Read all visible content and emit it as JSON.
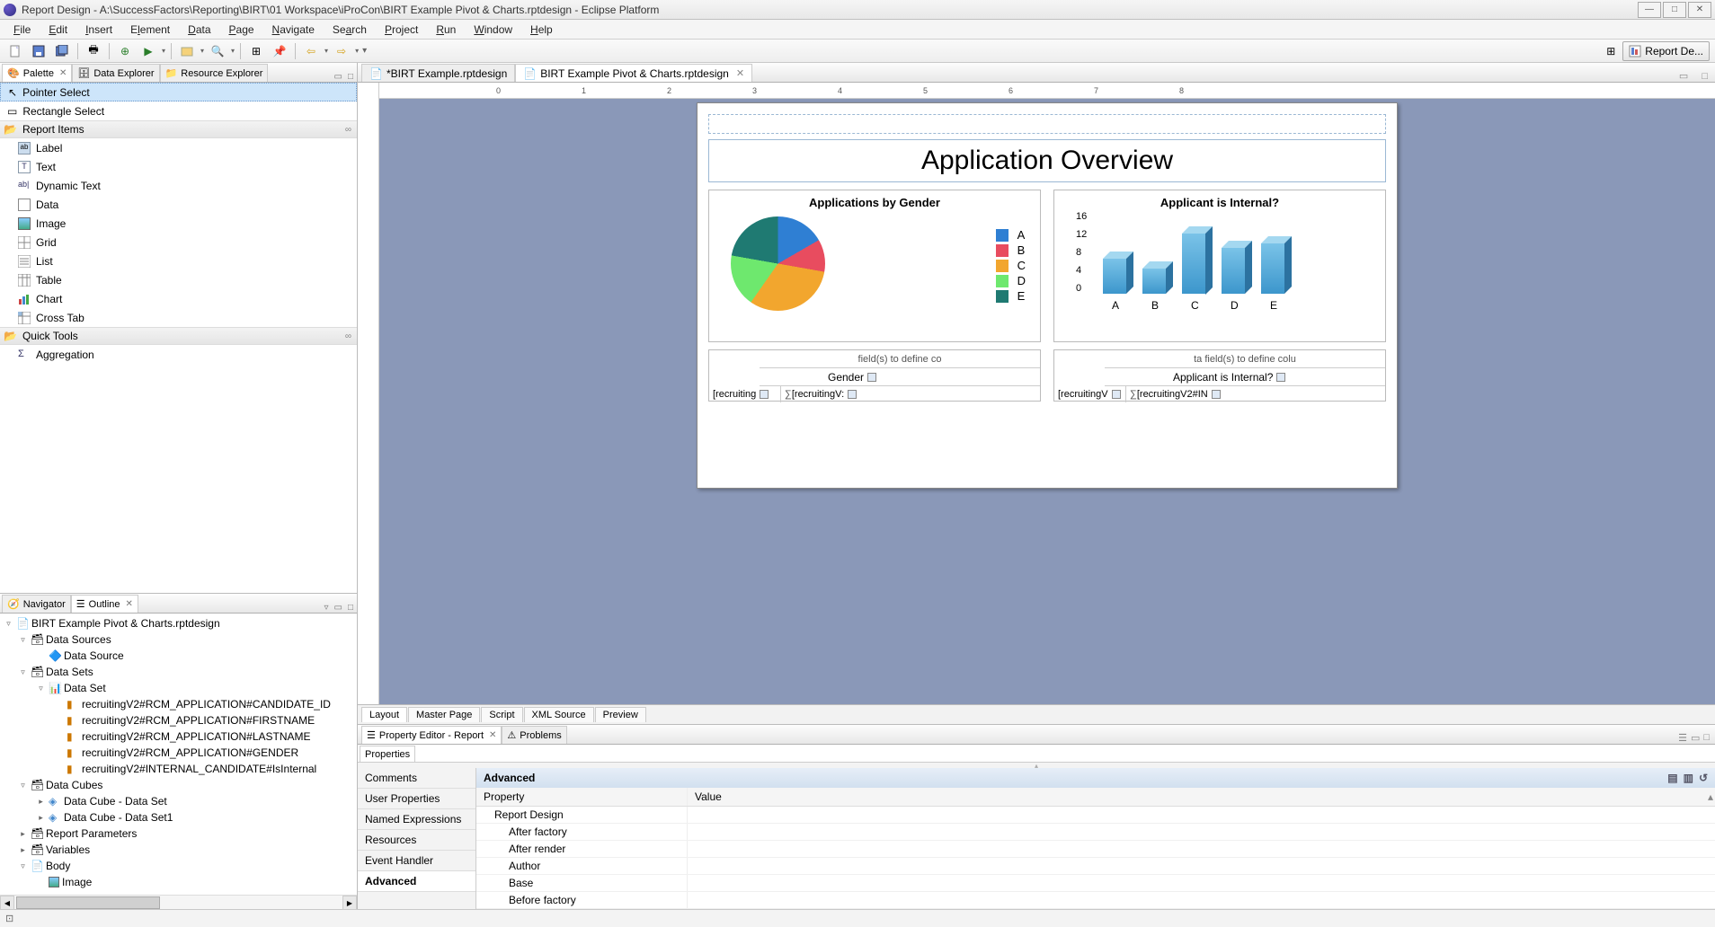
{
  "title": "Report Design - A:\\SuccessFactors\\Reporting\\BIRT\\01 Workspace\\iProCon\\BIRT Example Pivot & Charts.rptdesign - Eclipse Platform",
  "menus": [
    "File",
    "Edit",
    "Insert",
    "Element",
    "Data",
    "Page",
    "Navigate",
    "Search",
    "Project",
    "Run",
    "Window",
    "Help"
  ],
  "perspective": "Report De...",
  "left_tabs": {
    "palette": "Palette",
    "data_explorer": "Data Explorer",
    "resource_explorer": "Resource Explorer"
  },
  "palette": {
    "pointer_select": "Pointer Select",
    "rectangle_select": "Rectangle Select",
    "report_items_header": "Report Items",
    "items": [
      "Label",
      "Text",
      "Dynamic Text",
      "Data",
      "Image",
      "Grid",
      "List",
      "Table",
      "Chart",
      "Cross Tab"
    ],
    "quick_tools_header": "Quick Tools",
    "aggregation": "Aggregation"
  },
  "nav_tabs": {
    "navigator": "Navigator",
    "outline": "Outline"
  },
  "outline": {
    "root": "BIRT Example Pivot & Charts.rptdesign",
    "data_sources": "Data Sources",
    "data_source": "Data Source",
    "data_sets": "Data Sets",
    "data_set": "Data Set",
    "cols": [
      "recruitingV2#RCM_APPLICATION#CANDIDATE_ID",
      "recruitingV2#RCM_APPLICATION#FIRSTNAME",
      "recruitingV2#RCM_APPLICATION#LASTNAME",
      "recruitingV2#RCM_APPLICATION#GENDER",
      "recruitingV2#INTERNAL_CANDIDATE#IsInternal"
    ],
    "data_cubes": "Data Cubes",
    "cube1": "Data Cube - Data Set",
    "cube2": "Data Cube - Data Set1",
    "report_params": "Report Parameters",
    "variables": "Variables",
    "body": "Body",
    "image": "Image"
  },
  "editor_tabs": {
    "t1": "*BIRT Example.rptdesign",
    "t2": "BIRT Example Pivot & Charts.rptdesign"
  },
  "report": {
    "title": "Application Overview",
    "pie_title": "Applications by Gender",
    "bar_title": "Applicant is Internal?",
    "legend": [
      "A",
      "B",
      "C",
      "D",
      "E"
    ],
    "ct1_hint": "field(s) to define co",
    "ct1_dim": "Gender",
    "ct1_row": "[recruiting",
    "ct1_measure": "[recruitingV:",
    "ct2_hint": "ta field(s) to define colu",
    "ct2_dim": "Applicant is Internal?",
    "ct2_row": "[recruitingV",
    "ct2_measure": "[recruitingV2#IN"
  },
  "designer_tabs": [
    "Layout",
    "Master Page",
    "Script",
    "XML Source",
    "Preview"
  ],
  "prop_tabs": {
    "editor": "Property Editor - Report",
    "problems": "Problems"
  },
  "prop_subtab": "Properties",
  "prop_categories": [
    "Comments",
    "User Properties",
    "Named Expressions",
    "Resources",
    "Event Handler",
    "Advanced"
  ],
  "prop_head": "Advanced",
  "prop_cols": {
    "p": "Property",
    "v": "Value"
  },
  "prop_rows": [
    "Report Design",
    "After factory",
    "After render",
    "Author",
    "Base",
    "Before factory"
  ],
  "chart_data": [
    {
      "type": "pie",
      "title": "Applications by Gender",
      "categories": [
        "A",
        "B",
        "C",
        "D",
        "E"
      ],
      "values": [
        17,
        11,
        32,
        18,
        22
      ],
      "colors": [
        "#2f7fd3",
        "#e84c5f",
        "#f2a62e",
        "#6ee86e",
        "#1f7a72"
      ]
    },
    {
      "type": "bar",
      "title": "Applicant is Internal?",
      "categories": [
        "A",
        "B",
        "C",
        "D",
        "E"
      ],
      "values": [
        7,
        5,
        12,
        9,
        10
      ],
      "ylim": [
        0,
        16
      ],
      "yticks": [
        0,
        4,
        8,
        12,
        16
      ],
      "color": "#3c96cc"
    }
  ]
}
